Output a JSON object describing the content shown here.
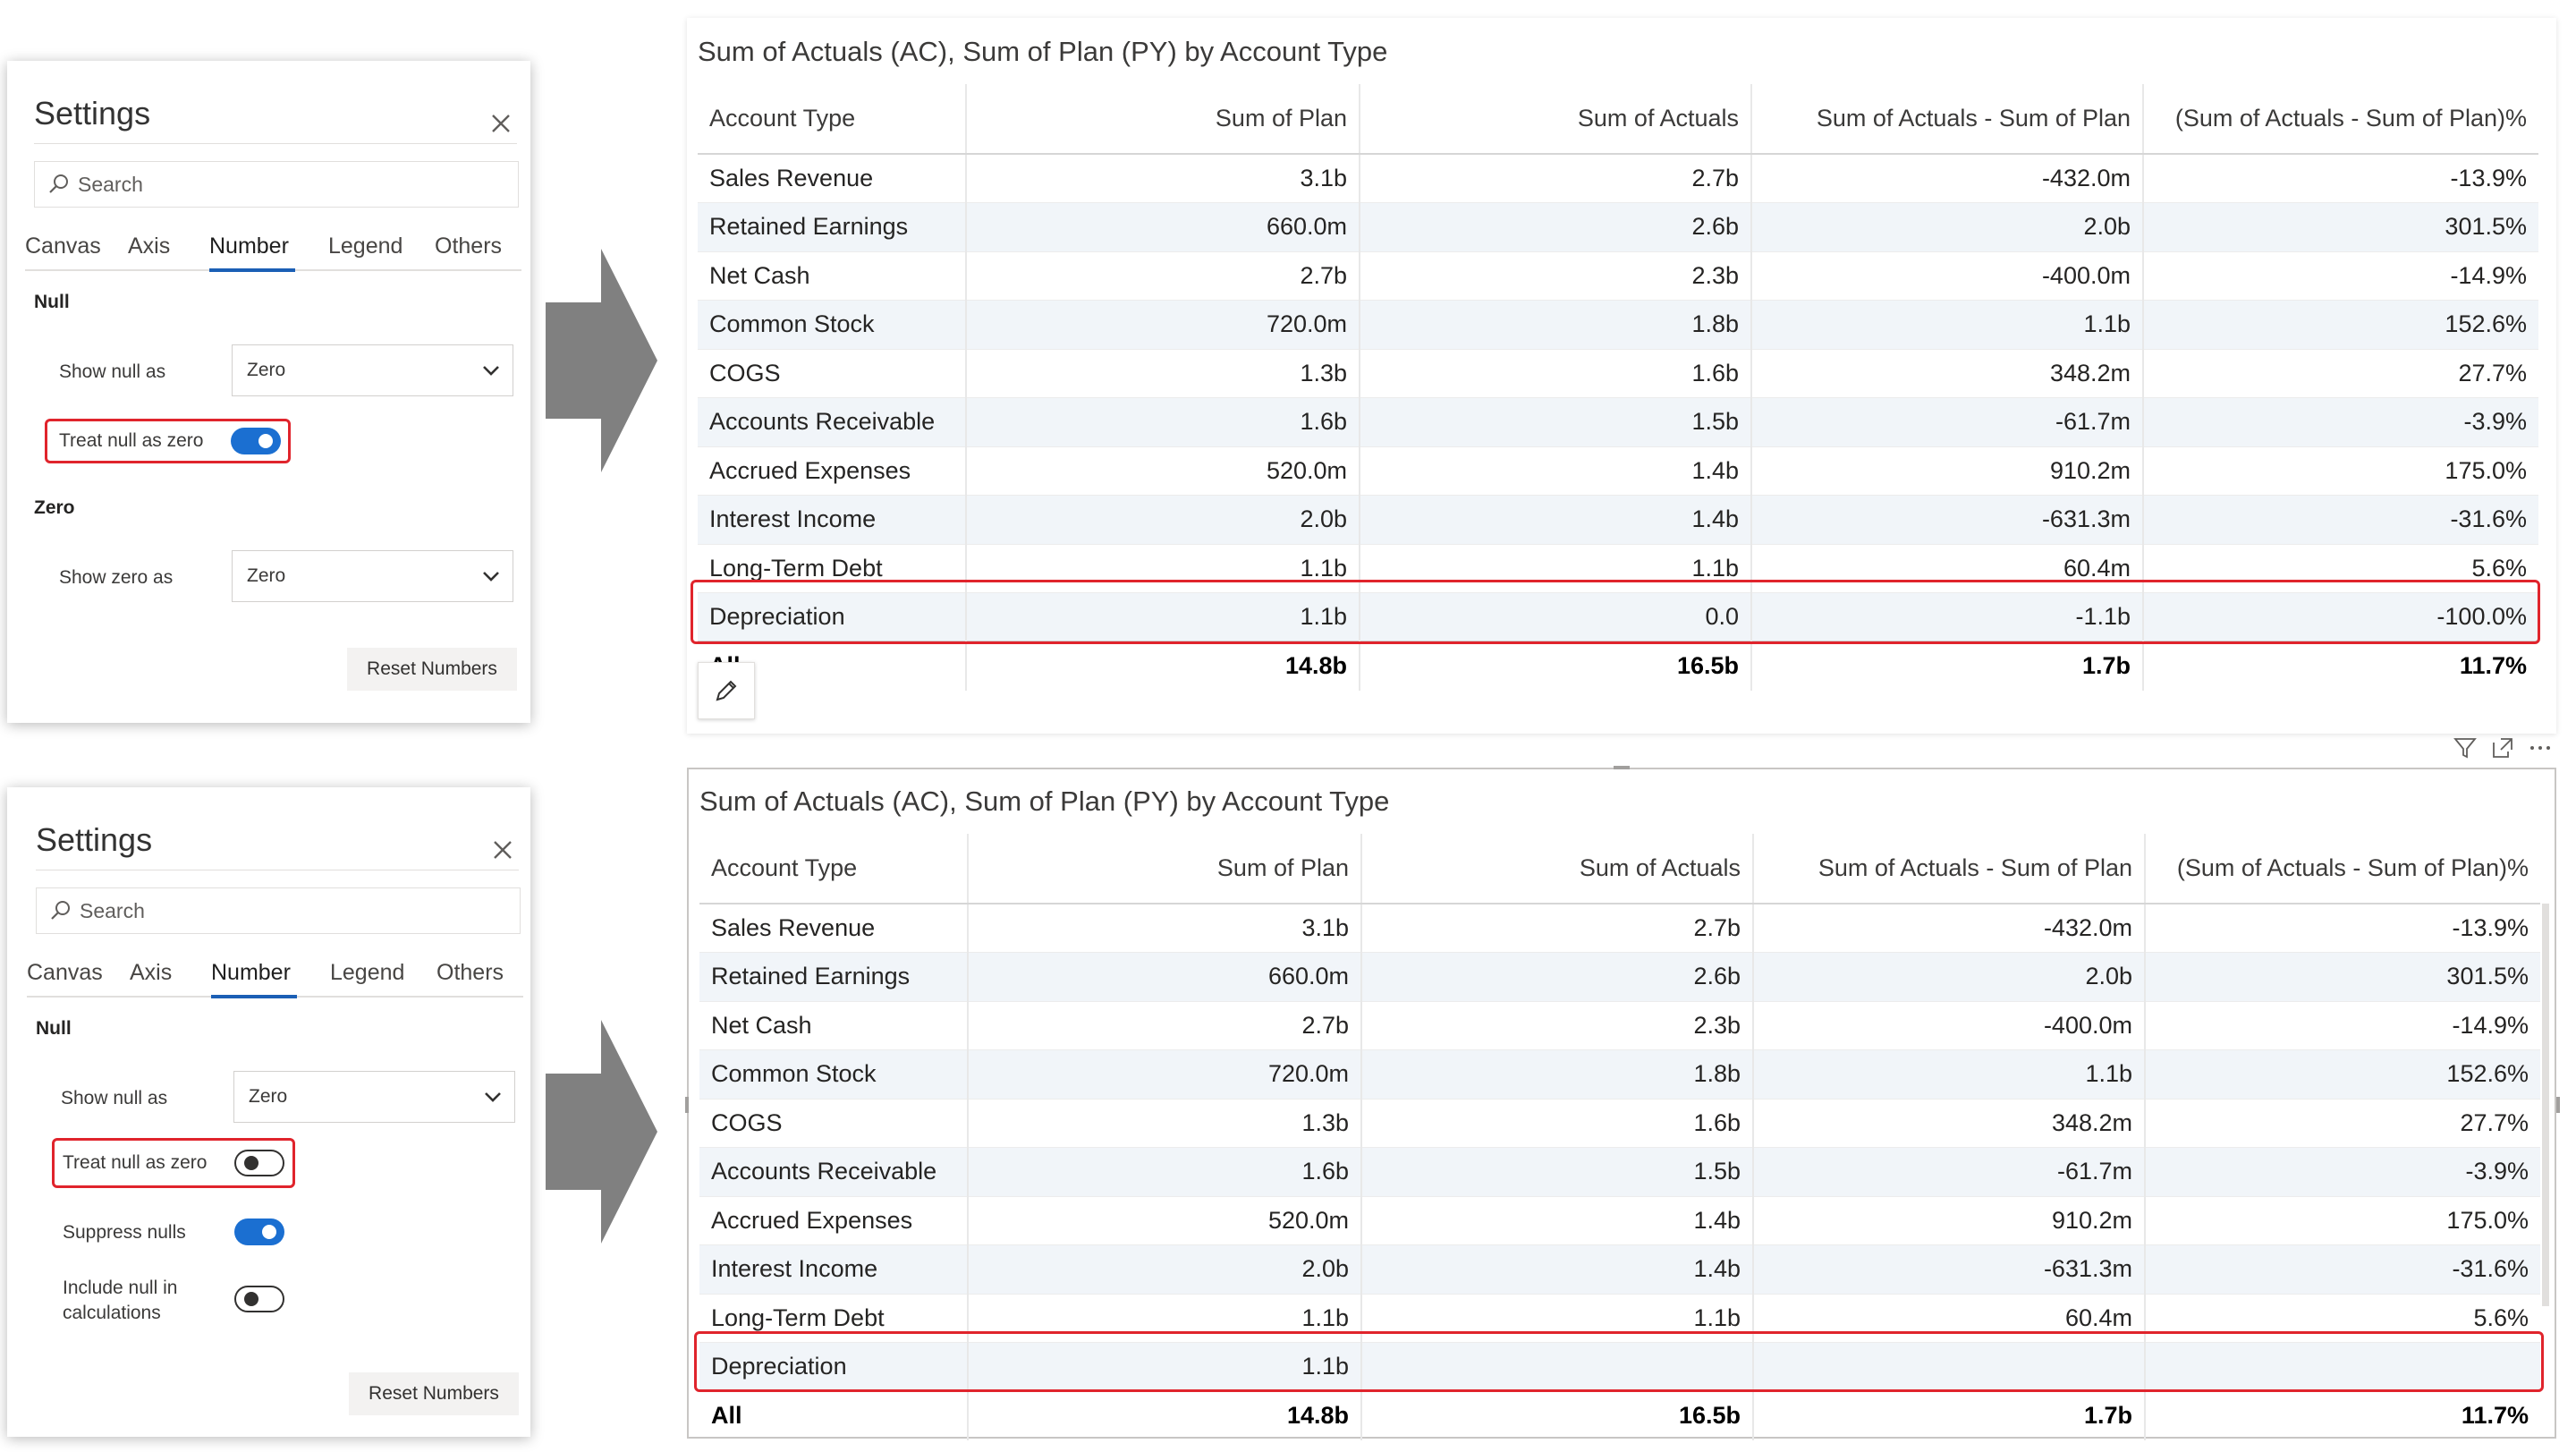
{
  "panel1": {
    "title": "Settings",
    "search_placeholder": "Search",
    "tabs": [
      "Canvas",
      "Axis",
      "Number",
      "Legend",
      "Others"
    ],
    "active_tab": "Number",
    "null_section": "Null",
    "show_null_label": "Show null as",
    "show_null_value": "Zero",
    "treat_null_label": "Treat null as zero",
    "treat_null_on": true,
    "zero_section": "Zero",
    "show_zero_label": "Show zero as",
    "show_zero_value": "Zero",
    "reset_button": "Reset Numbers"
  },
  "panel2": {
    "title": "Settings",
    "search_placeholder": "Search",
    "tabs": [
      "Canvas",
      "Axis",
      "Number",
      "Legend",
      "Others"
    ],
    "active_tab": "Number",
    "null_section": "Null",
    "show_null_label": "Show null as",
    "show_null_value": "Zero",
    "treat_null_label": "Treat null as zero",
    "treat_null_on": false,
    "suppress_nulls_label": "Suppress nulls",
    "suppress_nulls_on": true,
    "include_null_label_1": "Include null in",
    "include_null_label_2": "calculations",
    "include_null_on": false,
    "reset_button": "Reset Numbers"
  },
  "colors": {
    "negative": "#e8232b",
    "positive": "#7cb800",
    "accent": "#1b6fd1",
    "highlight": "#e0242c",
    "arrow": "#808080"
  },
  "visual1": {
    "title": "Sum of Actuals (AC), Sum of Plan (PY) by Account Type",
    "columns": [
      "Account Type",
      "Sum of Plan",
      "Sum of Actuals",
      "Sum of Actuals - Sum of Plan",
      "(Sum of Actuals - Sum of Plan)%"
    ],
    "rows": [
      [
        "Sales Revenue",
        "3.1b",
        "2.7b",
        "-432.0m",
        "-13.9%"
      ],
      [
        "Retained Earnings",
        "660.0m",
        "2.6b",
        "2.0b",
        "301.5%"
      ],
      [
        "Net Cash",
        "2.7b",
        "2.3b",
        "-400.0m",
        "-14.9%"
      ],
      [
        "Common Stock",
        "720.0m",
        "1.8b",
        "1.1b",
        "152.6%"
      ],
      [
        "COGS",
        "1.3b",
        "1.6b",
        "348.2m",
        "27.7%"
      ],
      [
        "Accounts Receivable",
        "1.6b",
        "1.5b",
        "-61.7m",
        "-3.9%"
      ],
      [
        "Accrued Expenses",
        "520.0m",
        "1.4b",
        "910.2m",
        "175.0%"
      ],
      [
        "Interest Income",
        "2.0b",
        "1.4b",
        "-631.3m",
        "-31.6%"
      ],
      [
        "Long-Term Debt",
        "1.1b",
        "1.1b",
        "60.4m",
        "5.6%"
      ],
      [
        "Depreciation",
        "1.1b",
        "0.0",
        "-1.1b",
        "-100.0%"
      ]
    ],
    "total": [
      "All",
      "14.8b",
      "16.5b",
      "1.7b",
      "11.7%"
    ]
  },
  "visual2": {
    "title": "Sum of Actuals (AC), Sum of Plan (PY) by Account Type",
    "columns": [
      "Account Type",
      "Sum of Plan",
      "Sum of Actuals",
      "Sum of Actuals - Sum of Plan",
      "(Sum of Actuals - Sum of Plan)%"
    ],
    "rows": [
      [
        "Sales Revenue",
        "3.1b",
        "2.7b",
        "-432.0m",
        "-13.9%"
      ],
      [
        "Retained Earnings",
        "660.0m",
        "2.6b",
        "2.0b",
        "301.5%"
      ],
      [
        "Net Cash",
        "2.7b",
        "2.3b",
        "-400.0m",
        "-14.9%"
      ],
      [
        "Common Stock",
        "720.0m",
        "1.8b",
        "1.1b",
        "152.6%"
      ],
      [
        "COGS",
        "1.3b",
        "1.6b",
        "348.2m",
        "27.7%"
      ],
      [
        "Accounts Receivable",
        "1.6b",
        "1.5b",
        "-61.7m",
        "-3.9%"
      ],
      [
        "Accrued Expenses",
        "520.0m",
        "1.4b",
        "910.2m",
        "175.0%"
      ],
      [
        "Interest Income",
        "2.0b",
        "1.4b",
        "-631.3m",
        "-31.6%"
      ],
      [
        "Long-Term Debt",
        "1.1b",
        "1.1b",
        "60.4m",
        "5.6%"
      ],
      [
        "Depreciation",
        "1.1b",
        "",
        "",
        ""
      ]
    ],
    "total": [
      "All",
      "14.8b",
      "16.5b",
      "1.7b",
      "11.7%"
    ]
  }
}
